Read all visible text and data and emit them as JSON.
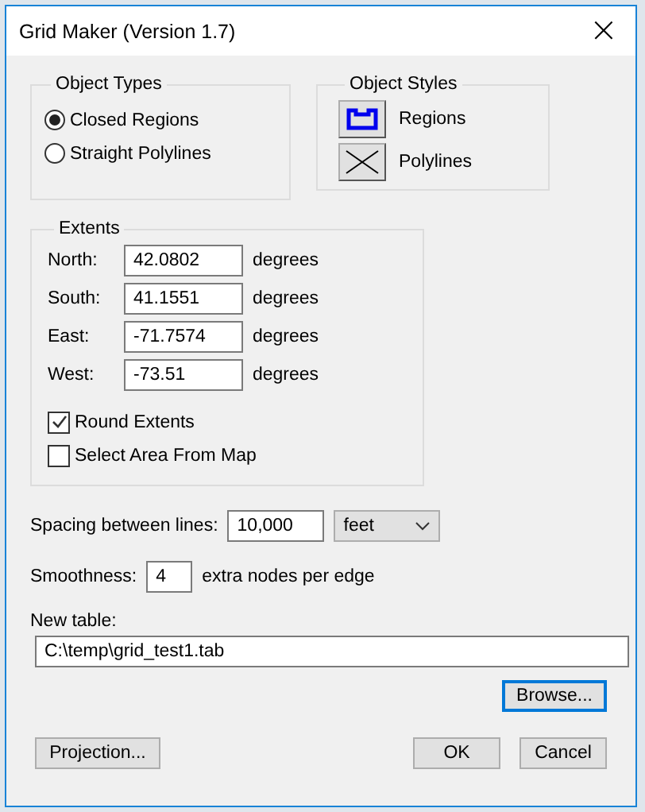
{
  "window": {
    "title": "Grid Maker (Version 1.7)",
    "close": "×"
  },
  "object_types": {
    "title": "Object Types",
    "options": [
      {
        "label": "Closed Regions",
        "selected": true
      },
      {
        "label": "Straight Polylines",
        "selected": false
      }
    ]
  },
  "object_styles": {
    "title": "Object Styles",
    "items": [
      {
        "kind": "region",
        "label": "Regions"
      },
      {
        "kind": "polyline",
        "label": "Polylines"
      }
    ]
  },
  "extents": {
    "title": "Extents",
    "rows": [
      {
        "label": "North:",
        "value": "42.0802",
        "unit": "degrees"
      },
      {
        "label": "South:",
        "value": "41.1551",
        "unit": "degrees"
      },
      {
        "label": "East:",
        "value": "-71.7574",
        "unit": "degrees"
      },
      {
        "label": "West:",
        "value": "-73.51",
        "unit": "degrees"
      }
    ],
    "checks": [
      {
        "label": "Round Extents",
        "checked": true
      },
      {
        "label": "Select Area From Map",
        "checked": false
      }
    ]
  },
  "spacing": {
    "label": "Spacing between lines:",
    "value": "10,000",
    "unit": "feet"
  },
  "smoothness": {
    "label": "Smoothness:",
    "value": "4",
    "suffix": "extra nodes per edge"
  },
  "new_table": {
    "label": "New table:",
    "value": "C:\\temp\\grid_test1.tab"
  },
  "browse_button": {
    "label": "Browse...",
    "focused": true
  },
  "buttons": [
    {
      "kind": "left",
      "label": "Projection..."
    },
    {
      "kind": "right",
      "label": "OK"
    },
    {
      "kind": "right",
      "label": "Cancel"
    }
  ]
}
